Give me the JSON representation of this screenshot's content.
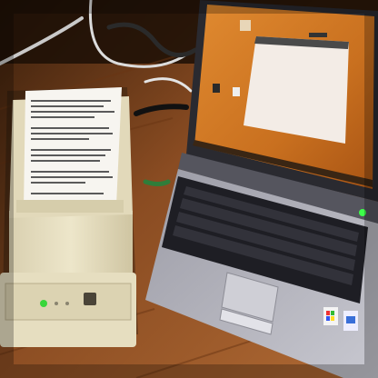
{
  "scene": {
    "description_free": true
  },
  "printer": {
    "status_led_color": "#39d63a"
  },
  "laptop": {
    "screen_wallpaper_color": "#c9701f",
    "power_led_color": "#3dff4a",
    "stickers": [
      "windows-logo-icon",
      "intel-inside-icon"
    ]
  },
  "colors": {
    "table_wood": "#9a5a2a",
    "printer_body": "#e8e0c4",
    "laptop_body": "#b8b8c0",
    "keyboard": "#1e1e24"
  }
}
